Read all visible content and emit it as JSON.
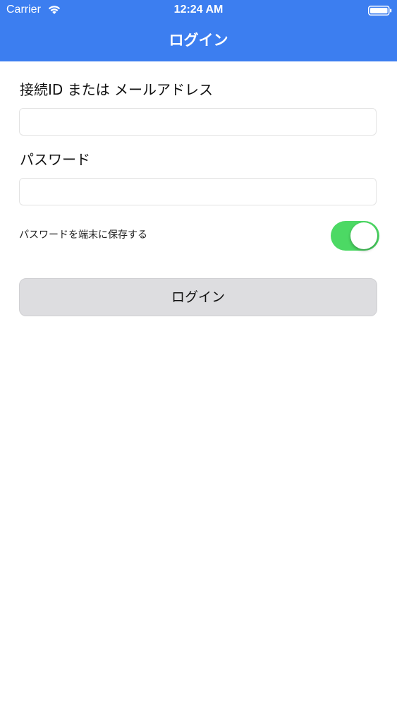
{
  "status_bar": {
    "carrier": "Carrier",
    "time": "12:24 AM",
    "wifi_icon": "wifi-icon",
    "battery_icon": "battery-icon"
  },
  "nav": {
    "title": "ログイン",
    "color": "#3c7ef0"
  },
  "form": {
    "id_label": "接続ID または メールアドレス",
    "id_value": "",
    "password_label": "パスワード",
    "password_value": "",
    "save_password_label": "パスワードを端末に保存する",
    "save_password_on": true,
    "toggle_color": "#4cd964",
    "login_button_label": "ログイン"
  }
}
